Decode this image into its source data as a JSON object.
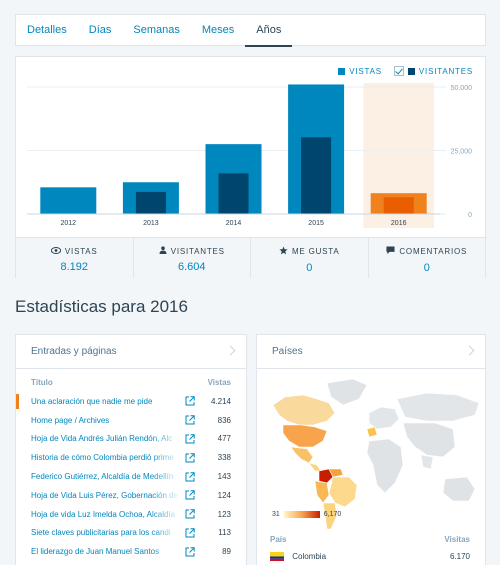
{
  "tabs": [
    {
      "label": "Detalles",
      "active": false
    },
    {
      "label": "Días",
      "active": false
    },
    {
      "label": "Semanas",
      "active": false
    },
    {
      "label": "Meses",
      "active": false
    },
    {
      "label": "Años",
      "active": true
    }
  ],
  "chart_data": {
    "type": "bar",
    "categories": [
      "2012",
      "2013",
      "2014",
      "2015",
      "2016"
    ],
    "series": [
      {
        "name": "VISTAS",
        "values": [
          10500,
          12500,
          27500,
          51000,
          8192
        ],
        "color": "#0087be"
      },
      {
        "name": "VISITANTES",
        "values": [
          0,
          8700,
          16000,
          30200,
          6604
        ],
        "color": "#00456d"
      }
    ],
    "y_ticks": [
      "50.000",
      "25.000",
      "0"
    ],
    "ylim": [
      0,
      50000
    ],
    "highlight_category": "2016",
    "highlight_colors": {
      "vistas": "#f0821e",
      "visitantes": "#e85e00",
      "band": "#fcefe3"
    },
    "legend": {
      "vistas": "VISTAS",
      "visitantes": "VISITANTES",
      "visitantes_checked": true,
      "position": "top-right"
    }
  },
  "summary": [
    {
      "label": "VISTAS",
      "value": "8.192",
      "icon": "eye-icon",
      "active": true
    },
    {
      "label": "VISITANTES",
      "value": "6.604",
      "icon": "person-icon",
      "active": false
    },
    {
      "label": "ME GUSTA",
      "value": "0",
      "icon": "star-icon",
      "active": false
    },
    {
      "label": "COMENTARIOS",
      "value": "0",
      "icon": "comment-icon",
      "active": false
    }
  ],
  "section_title": "Estadísticas para 2016",
  "posts": {
    "title": "Entradas y páginas",
    "col_title": "Título",
    "col_views": "Vistas",
    "rows": [
      {
        "title": "Una aclaración que nadie me pide",
        "views": "4.214",
        "highlight": true
      },
      {
        "title": "Home page / Archives",
        "views": "836"
      },
      {
        "title": "Hoja de Vida Andrés Julián Rendón, Alc",
        "views": "477"
      },
      {
        "title": "Historia de cómo Colombia perdió prime",
        "views": "338"
      },
      {
        "title": "Federico Gutiérrez, Alcaldía de Medellín",
        "views": "143"
      },
      {
        "title": "Hoja de Vida Luis Pérez, Gobernación de",
        "views": "124"
      },
      {
        "title": "Hoja de vida Luz Imelda Ochoa, Alcaldía",
        "views": "123"
      },
      {
        "title": "Siete claves publicitarias para los candi",
        "views": "113"
      },
      {
        "title": "El liderazgo de Juan Manuel Santos",
        "views": "89"
      }
    ]
  },
  "countries": {
    "title": "Países",
    "scale_min": "31",
    "scale_max": "6,170",
    "col_country": "País",
    "col_views": "Visitas",
    "rows": [
      {
        "name": "Colombia",
        "views": "6.170"
      }
    ]
  }
}
